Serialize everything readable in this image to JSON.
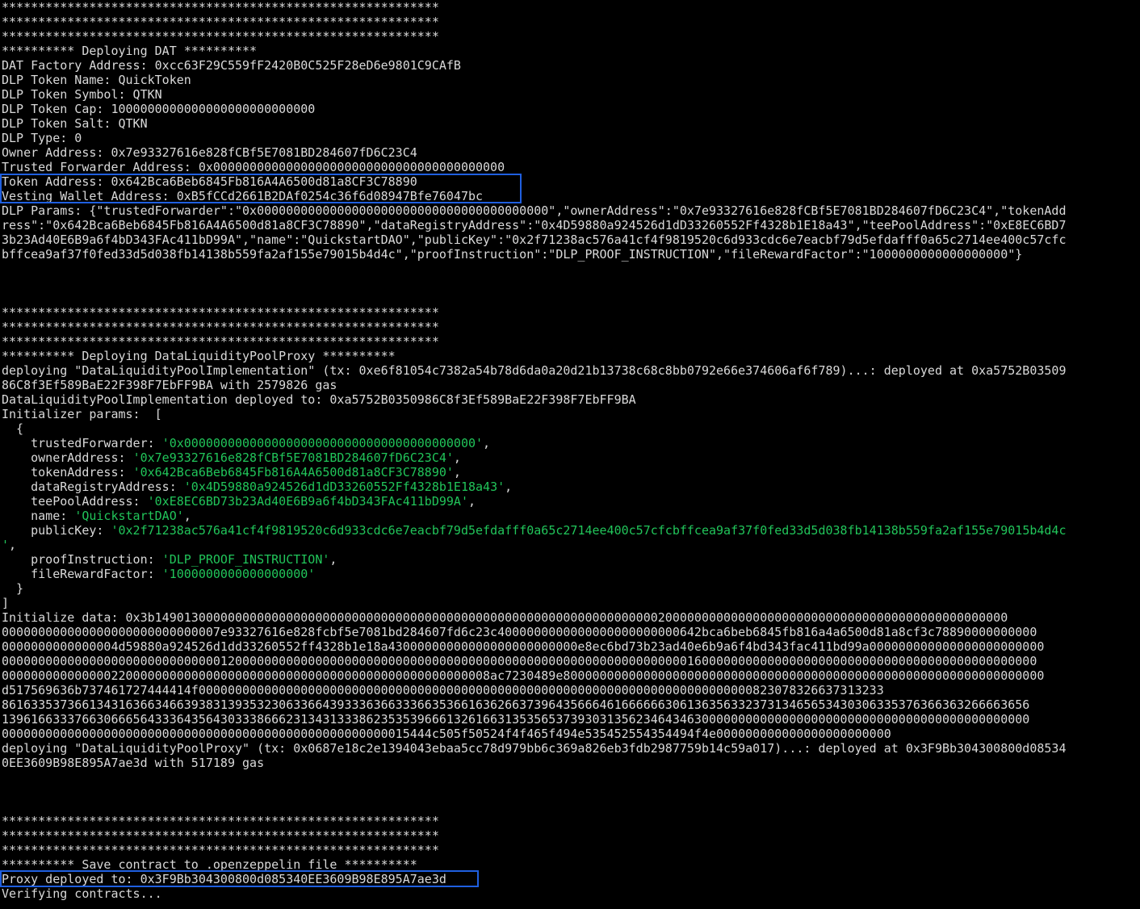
{
  "colors": {
    "background": "#000000",
    "text": "#d9d9d9",
    "string": "#21c55a",
    "highlight_border": "#1f5fe0"
  },
  "stars": "************************************************************",
  "dat": {
    "header": "********** Deploying DAT **********",
    "factory": "DAT Factory Address: 0xcc63F29C559fF2420B0C525F28eD6e9801C9CAfB",
    "token_name": "DLP Token Name: QuickToken",
    "token_symbol": "DLP Token Symbol: QTKN",
    "token_cap": "DLP Token Cap: 1000000000000000000000000000",
    "token_salt": "DLP Token Salt: QTKN",
    "dlp_type": "DLP Type: 0",
    "owner": "Owner Address: 0x7e93327616e828fCBf5E7081BD284607fD6C23C4",
    "trusted_forwarder": "Trusted Forwarder Address: 0x0000000000000000000000000000000000000000",
    "token_address": "Token Address: 0x642Bca6Beb6845Fb816A4A6500d81a8CF3C78890",
    "vesting_wallet": "Vesting Wallet Address: 0xB5fCCd2661B2DAf0254c36f6d08947Bfe76047bc",
    "params": [
      "DLP Params: {\"trustedForwarder\":\"0x0000000000000000000000000000000000000000\",\"ownerAddress\":\"0x7e93327616e828fCBf5E7081BD284607fD6C23C4\",\"tokenAdd",
      "ress\":\"0x642Bca6Beb6845Fb816A4A6500d81a8CF3C78890\",\"dataRegistryAddress\":\"0x4D59880a924526d1dD33260552Ff4328b1E18a43\",\"teePoolAddress\":\"0xE8EC6BD7",
      "3b23Ad40E6B9a6f4bD343FAc411bD99A\",\"name\":\"QuickstartDAO\",\"publicKey\":\"0x2f71238ac576a41cf4f9819520c6d933cdc6e7eacbf79d5efdafff0a65c2714ee400c57cfc",
      "bffcea9af37f0fed33d5d038fb14138b559fa2af155e79015b4d4c\",\"proofInstruction\":\"DLP_PROOF_INSTRUCTION\",\"fileRewardFactor\":\"1000000000000000000\"}"
    ]
  },
  "proxy": {
    "header": "********** Deploying DataLiquidityPoolProxy **********",
    "deploy_impl": [
      "deploying \"DataLiquidityPoolImplementation\" (tx: 0xe6f81054c7382a54b78d6da0a20d21b13738c68c8bb0792e66e374606af6f789)...: deployed at 0xa5752B03509",
      "86C8f3Ef589BaE22F398F7EbFF9BA with 2579826 gas"
    ],
    "impl_deployed": "DataLiquidityPoolImplementation deployed to: 0xa5752B0350986C8f3Ef589BaE22F398F7EbFF9BA",
    "init_params_label": "Initializer params:  [",
    "open_brace": "  {",
    "fields": [
      {
        "key": "    trustedForwarder: ",
        "value": "'0x0000000000000000000000000000000000000000'",
        "tail": ","
      },
      {
        "key": "    ownerAddress: ",
        "value": "'0x7e93327616e828fCBf5E7081BD284607fD6C23C4'",
        "tail": ","
      },
      {
        "key": "    tokenAddress: ",
        "value": "'0x642Bca6Beb6845Fb816A4A6500d81a8CF3C78890'",
        "tail": ","
      },
      {
        "key": "    dataRegistryAddress: ",
        "value": "'0x4D59880a924526d1dD33260552Ff4328b1E18a43'",
        "tail": ","
      },
      {
        "key": "    teePoolAddress: ",
        "value": "'0xE8EC6BD73b23Ad40E6B9a6f4bD343FAc411bD99A'",
        "tail": ","
      },
      {
        "key": "    name: ",
        "value": "'QuickstartDAO'",
        "tail": ","
      },
      {
        "key": "    publicKey: ",
        "value": "'0x2f71238ac576a41cf4f9819520c6d933cdc6e7eacbf79d5efdafff0a65c2714ee400c57cfcbffcea9af37f0fed33d5d038fb14138b559fa2af155e79015b4d4c",
        "tail": ""
      }
    ],
    "pubkey_wrap": "'",
    "pubkey_wrap_tail": ",",
    "fields_after": [
      {
        "key": "    proofInstruction: ",
        "value": "'DLP_PROOF_INSTRUCTION'",
        "tail": ","
      },
      {
        "key": "    fileRewardFactor: ",
        "value": "'1000000000000000000'",
        "tail": ""
      }
    ],
    "close_brace": "  }",
    "close_bracket": "]",
    "init_data": [
      "Initialize data: 0x3b149013000000000000000000000000000000000000000000000000000000000000000200000000000000000000000000000000000000000000000",
      "000000000000000000000000000007e93327616e828fcbf5e7081bd284607fd6c23c4000000000000000000000000642bca6beb6845fb816a4a6500d81a8cf3c78890000000000",
      "0000000000000004d59880a924526d1dd33260552ff4328b1e18a43000000000000000000000000e8ec6bd73b23ad40e6b9a6f4bd343fac411bd99a000000000000000000000000",
      "0000000000000000000000000000001200000000000000000000000000000000000000000000000000000000000000160000000000000000000000000000000000000000000000",
      "0000000000000002200000000000000000000000000000000000000000000000008ac7230489e800000000000000000000000000000000000000000000000000000000000000000",
      "d517569636b737461727444414f0000000000000000000000000000000000000000000000000000000000000000000000000000823078326637313233",
      "861633537366134316366346639383139353230633664393336366333663536616362663739643566646166666630613635633237313465653430306335376366363266663656",
      "139616633376630666564333643564303338666231343133386235353966613261663135356537393031356234643463000000000000000000000000000000000000000000000",
      "00000000000000000000000000000000000000000000000000000015444c505f50524f4f465f494e535452554354494f4e000000000000000000000000",
      "deploying \"DataLiquidityPoolProxy\" (tx: 0x0687e18c2e1394043ebaa5cc78d979bb6c369a826eb3fdb2987759b14c59a017)...: deployed at 0x3F9Bb304300800d08534",
      "0EE3609B98E895A7ae3d with 517189 gas"
    ]
  },
  "save": {
    "header": "********** Save contract to .openzeppelin file **********",
    "proxy_deployed": "Proxy deployed to: 0x3F9Bb304300800d085340EE3609B98E895A7ae3d",
    "verifying": "Verifying contracts..."
  }
}
